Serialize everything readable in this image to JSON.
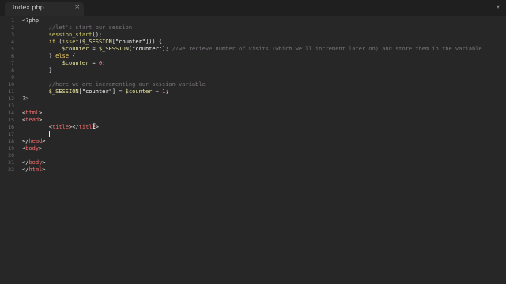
{
  "tab": {
    "label": "index.php",
    "close_icon": "×"
  },
  "tab_bar_menu_icon": "▾",
  "lines": [
    {
      "n": "1",
      "tokens": [
        {
          "t": "<?php",
          "c": "php"
        }
      ]
    },
    {
      "n": "2",
      "tokens": [
        {
          "t": "        //let's start our session",
          "c": "comment"
        }
      ]
    },
    {
      "n": "3",
      "tokens": [
        {
          "t": "        ",
          "c": "plain"
        },
        {
          "t": "session_start",
          "c": "function"
        },
        {
          "t": "();",
          "c": "plain"
        }
      ]
    },
    {
      "n": "4",
      "tokens": [
        {
          "t": "        ",
          "c": "plain"
        },
        {
          "t": "if",
          "c": "keyword"
        },
        {
          "t": " (",
          "c": "plain"
        },
        {
          "t": "isset",
          "c": "function"
        },
        {
          "t": "(",
          "c": "plain"
        },
        {
          "t": "$_SESSION",
          "c": "var"
        },
        {
          "t": "[",
          "c": "plain"
        },
        {
          "t": "\"counter\"",
          "c": "string"
        },
        {
          "t": "])) {",
          "c": "plain"
        }
      ]
    },
    {
      "n": "5",
      "tokens": [
        {
          "t": "            ",
          "c": "plain"
        },
        {
          "t": "$counter",
          "c": "var"
        },
        {
          "t": " = ",
          "c": "plain"
        },
        {
          "t": "$_SESSION",
          "c": "var"
        },
        {
          "t": "[",
          "c": "plain"
        },
        {
          "t": "\"counter\"",
          "c": "string"
        },
        {
          "t": "]; ",
          "c": "plain"
        },
        {
          "t": "//we recieve number of visits (which we'll increment later on) and store them in the variable",
          "c": "comment"
        }
      ]
    },
    {
      "n": "6",
      "tokens": [
        {
          "t": "        } ",
          "c": "plain"
        },
        {
          "t": "else",
          "c": "keyword"
        },
        {
          "t": " {",
          "c": "plain"
        }
      ]
    },
    {
      "n": "7",
      "tokens": [
        {
          "t": "            ",
          "c": "plain"
        },
        {
          "t": "$counter",
          "c": "var"
        },
        {
          "t": " = ",
          "c": "plain"
        },
        {
          "t": "0",
          "c": "number"
        },
        {
          "t": ";",
          "c": "plain"
        }
      ]
    },
    {
      "n": "8",
      "tokens": [
        {
          "t": "        }",
          "c": "plain"
        }
      ]
    },
    {
      "n": "9",
      "tokens": []
    },
    {
      "n": "10",
      "tokens": [
        {
          "t": "        //here we are incrementing our session variable",
          "c": "comment"
        }
      ]
    },
    {
      "n": "11",
      "tokens": [
        {
          "t": "        ",
          "c": "plain"
        },
        {
          "t": "$_SESSION",
          "c": "var"
        },
        {
          "t": "[",
          "c": "plain"
        },
        {
          "t": "\"counter\"",
          "c": "string"
        },
        {
          "t": "] = ",
          "c": "plain"
        },
        {
          "t": "$counter",
          "c": "var"
        },
        {
          "t": " + ",
          "c": "plain"
        },
        {
          "t": "1",
          "c": "number"
        },
        {
          "t": ";",
          "c": "plain"
        }
      ]
    },
    {
      "n": "12",
      "tokens": [
        {
          "t": "?>",
          "c": "php"
        }
      ]
    },
    {
      "n": "13",
      "tokens": []
    },
    {
      "n": "14",
      "tokens": [
        {
          "t": "<",
          "c": "plain"
        },
        {
          "t": "html",
          "c": "tag"
        },
        {
          "t": ">",
          "c": "plain"
        }
      ]
    },
    {
      "n": "15",
      "tokens": [
        {
          "t": "<",
          "c": "plain"
        },
        {
          "t": "head",
          "c": "tag"
        },
        {
          "t": ">",
          "c": "plain"
        }
      ]
    },
    {
      "n": "16",
      "tokens": [
        {
          "t": "        <",
          "c": "plain"
        },
        {
          "t": "title",
          "c": "tag"
        },
        {
          "t": "></",
          "c": "plain"
        },
        {
          "t": "title",
          "c": "tag"
        },
        {
          "t": ">",
          "c": "plain"
        }
      ]
    },
    {
      "n": "17",
      "tokens": []
    },
    {
      "n": "18",
      "tokens": [
        {
          "t": "</",
          "c": "plain"
        },
        {
          "t": "head",
          "c": "tag"
        },
        {
          "t": ">",
          "c": "plain"
        }
      ]
    },
    {
      "n": "19",
      "tokens": [
        {
          "t": "<",
          "c": "plain"
        },
        {
          "t": "body",
          "c": "tag"
        },
        {
          "t": ">",
          "c": "plain"
        }
      ]
    },
    {
      "n": "20",
      "tokens": []
    },
    {
      "n": "21",
      "tokens": [
        {
          "t": "</",
          "c": "plain"
        },
        {
          "t": "body",
          "c": "tag"
        },
        {
          "t": ">",
          "c": "plain"
        }
      ]
    },
    {
      "n": "22",
      "tokens": [
        {
          "t": "</",
          "c": "plain"
        },
        {
          "t": "html",
          "c": "tag"
        },
        {
          "t": ">",
          "c": "plain"
        }
      ]
    }
  ],
  "cursor": {
    "line": 17,
    "column": 8
  },
  "colors": {
    "background": "#272727",
    "tab_bar": "#1f1f1f",
    "comment": "#79737a",
    "keyword": "#f2d066",
    "tag": "#f26c6c",
    "number": "#ff8a8a"
  }
}
